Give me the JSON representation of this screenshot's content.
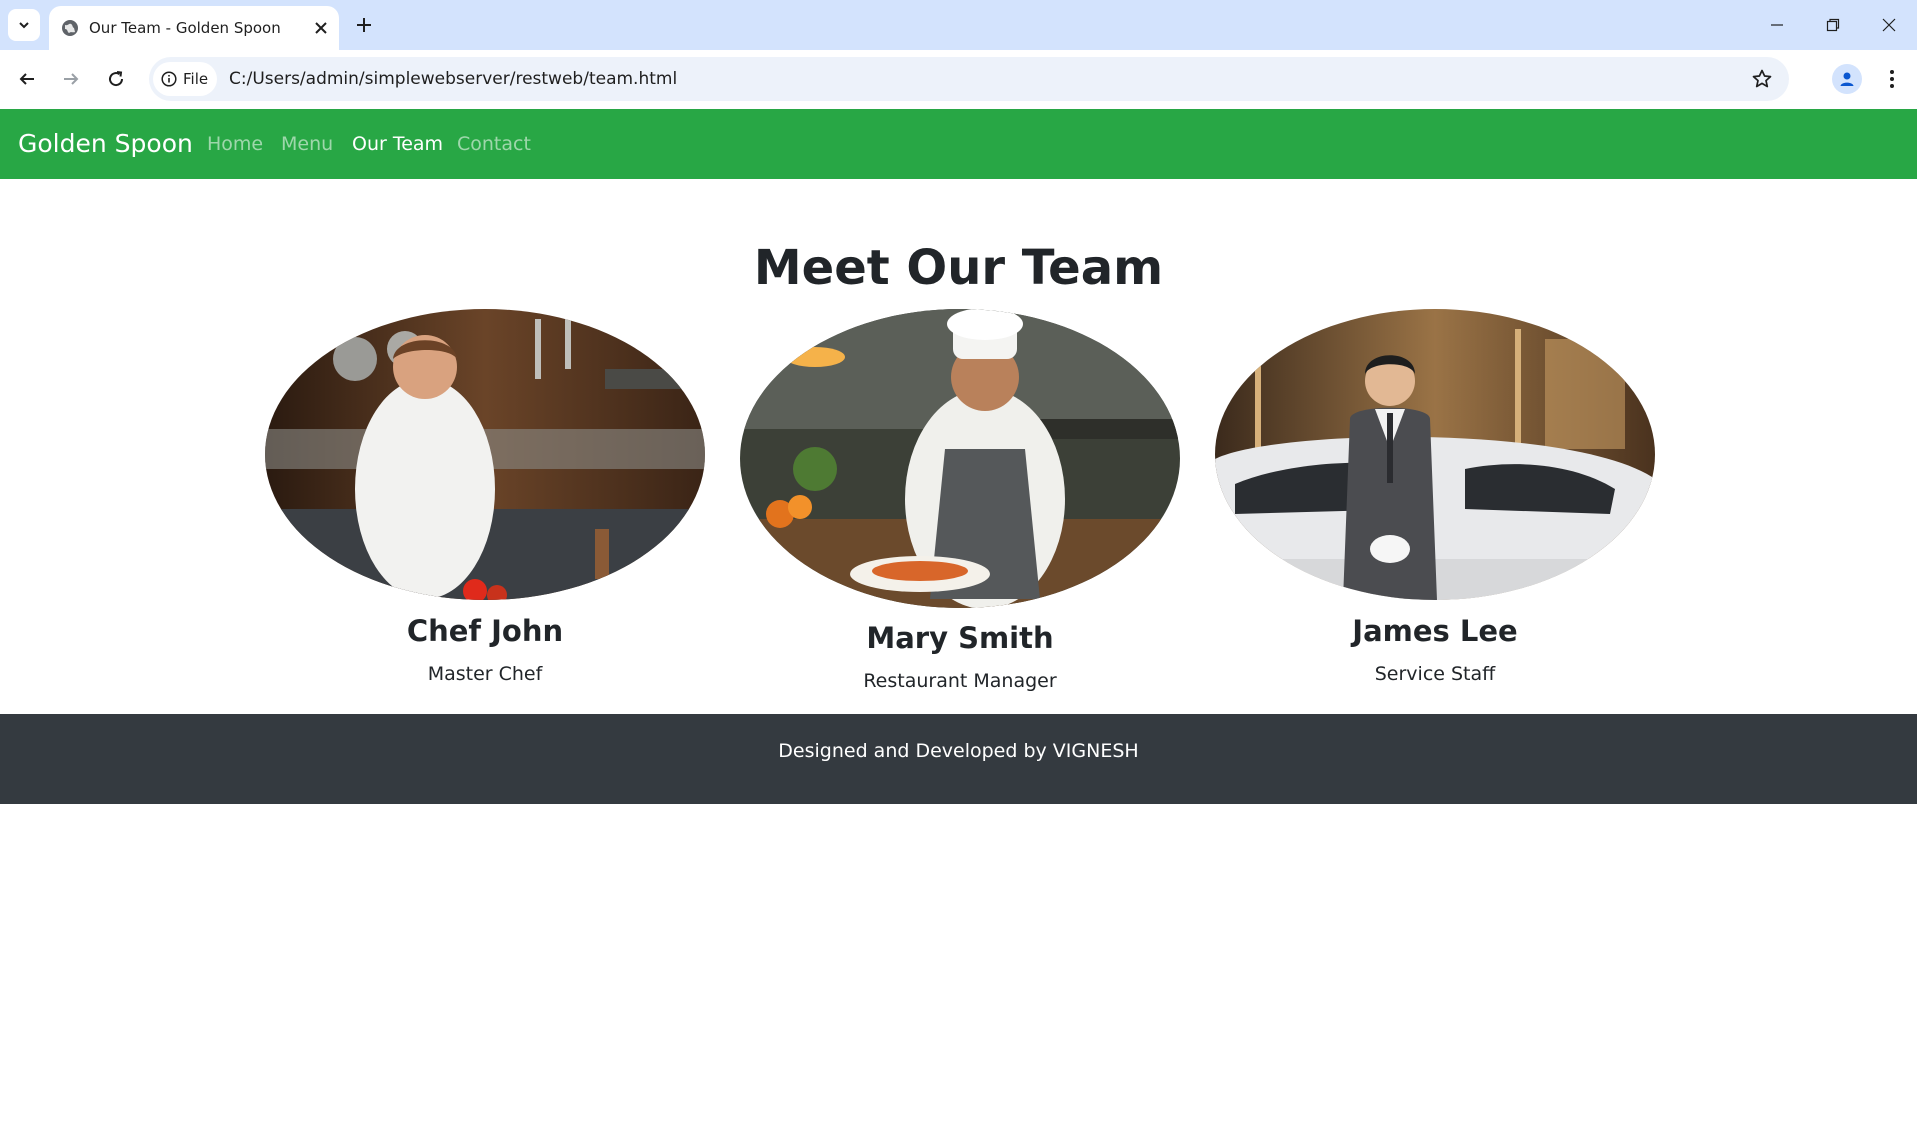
{
  "browser": {
    "tab_title": "Our Team - Golden Spoon",
    "file_chip_label": "File",
    "url": "C:/Users/admin/simplewebserver/restweb/team.html"
  },
  "site": {
    "brand": "Golden Spoon",
    "nav": [
      {
        "label": "Home",
        "active": false
      },
      {
        "label": "Menu",
        "active": false
      },
      {
        "label": "Our Team",
        "active": true
      },
      {
        "label": "Contact",
        "active": false
      }
    ],
    "heading": "Meet Our Team",
    "team": [
      {
        "name": "Chef John",
        "role": "Master Chef"
      },
      {
        "name": "Mary Smith",
        "role": "Restaurant Manager"
      },
      {
        "name": "James Lee",
        "role": "Service Staff"
      }
    ],
    "footer": "Designed and Developed by VIGNESH"
  },
  "colors": {
    "navbar": "#28a745",
    "footer": "#343a40",
    "tabstrip": "#d3e3fd"
  }
}
